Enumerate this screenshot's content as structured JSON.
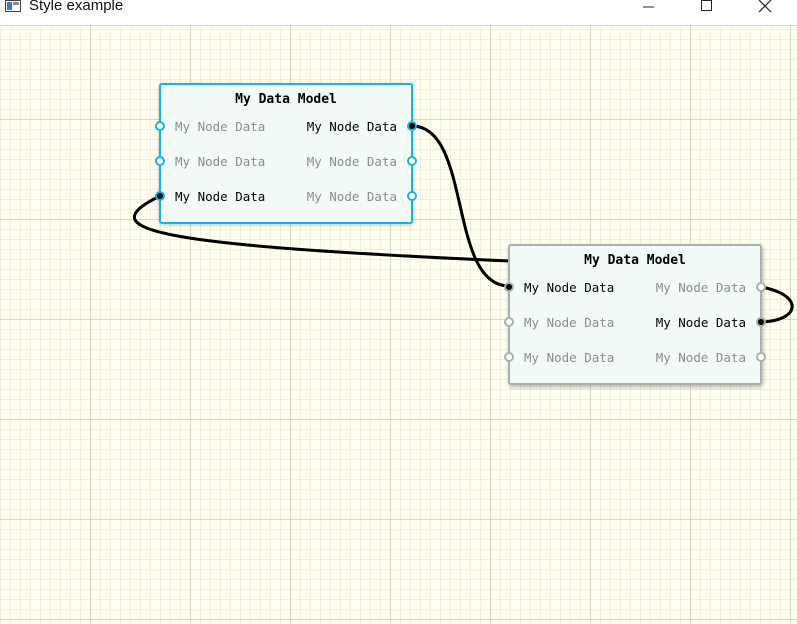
{
  "window": {
    "title": "Style example",
    "minimize_glyph": "—",
    "maximize_glyph": "☐",
    "close_glyph": "✕"
  },
  "nodes": [
    {
      "title": "My Data Model",
      "selected": true,
      "inputs": [
        {
          "label": "My Node Data",
          "connected": false
        },
        {
          "label": "My Node Data",
          "connected": false
        },
        {
          "label": "My Node Data",
          "connected": true
        }
      ],
      "outputs": [
        {
          "label": "My Node Data",
          "connected": true
        },
        {
          "label": "My Node Data",
          "connected": false
        },
        {
          "label": "My Node Data",
          "connected": false
        }
      ]
    },
    {
      "title": "My Data Model",
      "selected": false,
      "inputs": [
        {
          "label": "My Node Data",
          "connected": true
        },
        {
          "label": "My Node Data",
          "connected": false
        },
        {
          "label": "My Node Data",
          "connected": false
        }
      ],
      "outputs": [
        {
          "label": "My Node Data",
          "connected": false
        },
        {
          "label": "My Node Data",
          "connected": true
        },
        {
          "label": "My Node Data",
          "connected": false
        }
      ]
    }
  ],
  "colors": {
    "canvas_background": "#fffff0",
    "selected_border": "#19b2e6",
    "node_border": "#a9b0b0",
    "node_fill": "#f2fbf8",
    "connection": "#000000"
  }
}
